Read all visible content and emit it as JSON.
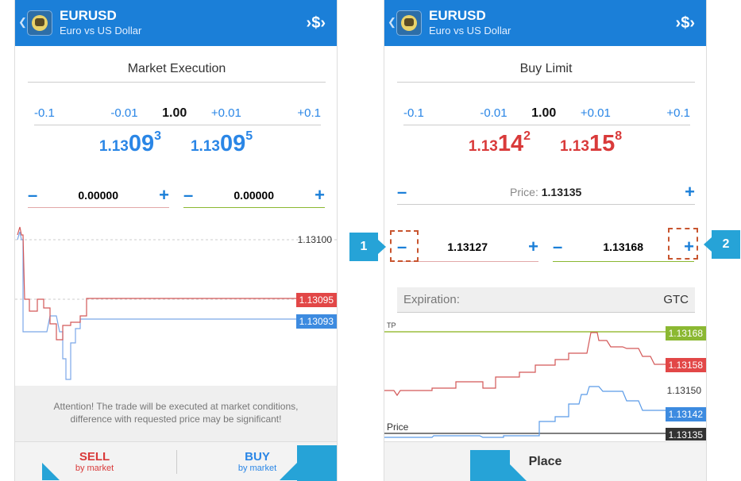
{
  "left": {
    "symbol": "EURUSD",
    "description": "Euro vs US Dollar",
    "order_type": "Market Execution",
    "volume": {
      "m1": "-0.1",
      "m2": "-0.01",
      "value": "1.00",
      "p1": "+0.01",
      "p2": "+0.1"
    },
    "bid": {
      "small": "1.13",
      "big": "09",
      "sup": "3"
    },
    "ask": {
      "small": "1.13",
      "big": "09",
      "sup": "5"
    },
    "sl_value": "0.00000",
    "tp_value": "0.00000",
    "price_labels": {
      "top": "1.13100",
      "red": "1.13095",
      "blue": "1.13093"
    },
    "notice": "Attention! The trade will be executed at market conditions, difference with requested price may be significant!",
    "sell": {
      "label": "SELL",
      "sub": "by market"
    },
    "buy": {
      "label": "BUY",
      "sub": "by market"
    }
  },
  "right": {
    "symbol": "EURUSD",
    "description": "Euro vs US Dollar",
    "order_type": "Buy Limit",
    "volume": {
      "m1": "-0.1",
      "m2": "-0.01",
      "value": "1.00",
      "p1": "+0.01",
      "p2": "+0.1"
    },
    "bid": {
      "small": "1.13",
      "big": "14",
      "sup": "2"
    },
    "ask": {
      "small": "1.13",
      "big": "15",
      "sup": "8"
    },
    "price_label": "Price:",
    "price_value": "1.13135",
    "sl_value": "1.13127",
    "tp_value": "1.13168",
    "expiration_label": "Expiration:",
    "expiration_value": "GTC",
    "chart_labels": {
      "tp_line": "TP",
      "price_line": "Price",
      "green": "1.13168",
      "red": "1.13158",
      "plain": "1.13150",
      "blue": "1.13142",
      "dark": "1.13135"
    },
    "place": "Place"
  },
  "callouts": {
    "one": "1",
    "two": "2"
  },
  "icons": {
    "back": "chevron-left-icon",
    "trade": "trade-icon",
    "minus": "minus-icon",
    "plus": "plus-icon"
  },
  "colors": {
    "header": "#1b7fd8",
    "blue": "#2a86e6",
    "red": "#d93a3a",
    "green": "#8bb832",
    "callout": "#26a3d7"
  }
}
